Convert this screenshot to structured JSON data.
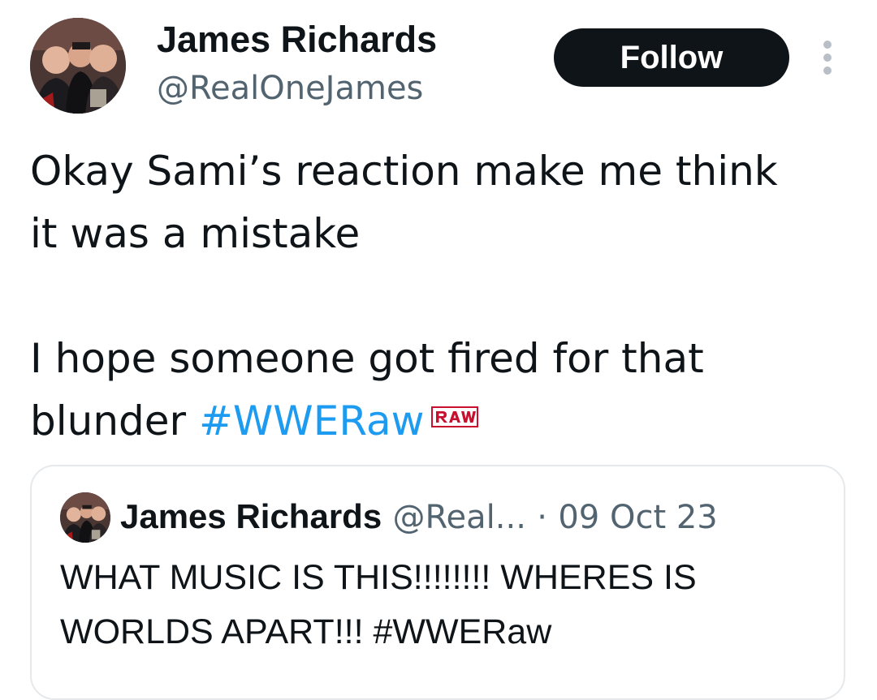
{
  "tweet": {
    "author": {
      "display_name": "James Richards",
      "handle": "@RealOneJames",
      "avatar": "group-photo-avatar"
    },
    "follow_label": "Follow",
    "more_icon": "more-vertical-icon",
    "text": {
      "line1": "Okay Sami’s reaction make me think",
      "line2": "it was a mistake",
      "line3": "I hope someone got fired for that",
      "line4_prefix": "blunder ",
      "hashtag": "#WWERaw",
      "hashtag_emoji": "raw-logo-icon"
    },
    "colors": {
      "text": "#0f1419",
      "secondary": "#536471",
      "link": "#1d9bf0",
      "follow_bg": "#0f1419",
      "follow_text": "#ffffff",
      "card_border": "#e6e9ec"
    }
  },
  "quoted_tweet": {
    "display_name": "James Richards",
    "handle": "@Real...",
    "separator": "·",
    "date": "09 Oct 23",
    "line1": "WHAT MUSIC IS THIS!!!!!!!! WHERES IS",
    "line2": "WORLDS APART!!!  #WWERaw"
  }
}
